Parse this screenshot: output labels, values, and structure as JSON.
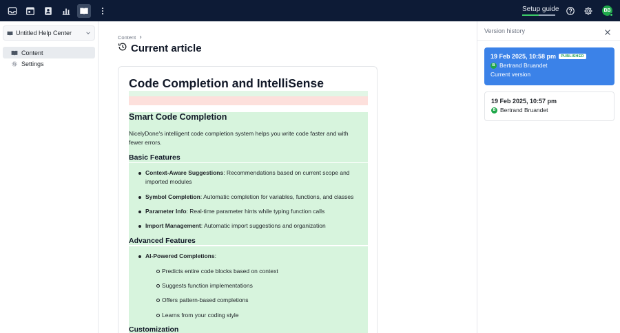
{
  "topbar": {
    "icons": [
      "inbox-icon",
      "calendar-icon",
      "contacts-icon",
      "reports-icon",
      "knowledge-base-icon",
      "more-vertical-icon"
    ],
    "setup_guide_label": "Setup guide",
    "setup_progress": 0.5,
    "help_icon": "help-icon",
    "settings_icon": "gear-icon",
    "avatar_initials": "BB"
  },
  "sidebar": {
    "help_center_name": "Untitled Help Center",
    "items": [
      {
        "label": "Content",
        "icon": "book-icon",
        "active": true
      },
      {
        "label": "Settings",
        "icon": "gear-icon",
        "active": false
      }
    ]
  },
  "main": {
    "breadcrumb": "Content",
    "page_title": "Current article",
    "article": {
      "h1": "Code Completion and IntelliSense",
      "h2_smart": "Smart Code Completion",
      "intro": "NicelyDone's intelligent code completion system helps you write code faster and with fewer errors.",
      "h3_basic": "Basic Features",
      "basic": [
        {
          "bold": "Context-Aware Suggestions",
          "rest": ": Recommendations based on current scope and imported modules"
        },
        {
          "bold": "Symbol Completion",
          "rest": ": Automatic completion for variables, functions, and classes"
        },
        {
          "bold": "Parameter Info",
          "rest": ": Real-time parameter hints while typing function calls"
        },
        {
          "bold": "Import Management",
          "rest": ": Automatic import suggestions and organization"
        }
      ],
      "h3_advanced": "Advanced Features",
      "advanced_item": {
        "bold": "AI-Powered Completions",
        "rest": ":"
      },
      "advanced_sub": [
        "Predicts entire code blocks based on context",
        "Suggests function implementations",
        "Offers pattern-based completions",
        "Learns from your coding style"
      ],
      "h3_custom": "Customization"
    }
  },
  "version_panel": {
    "title": "Version history",
    "versions": [
      {
        "date": "19 Feb 2025, 10:58 pm",
        "badge": "PUBLISHED",
        "author": "Bertrand Bruandet",
        "author_initial": "B",
        "status": "Current version"
      },
      {
        "date": "19 Feb 2025, 10:57 pm",
        "author": "Bertrand Bruandet",
        "author_initial": "B"
      }
    ]
  },
  "colors": {
    "topbar": "#0d1b36",
    "accent_blue": "#3b82e8",
    "diff_added": "#d7f4dd",
    "diff_removed": "#fde0dc",
    "avatar_green": "#1fa84a"
  }
}
